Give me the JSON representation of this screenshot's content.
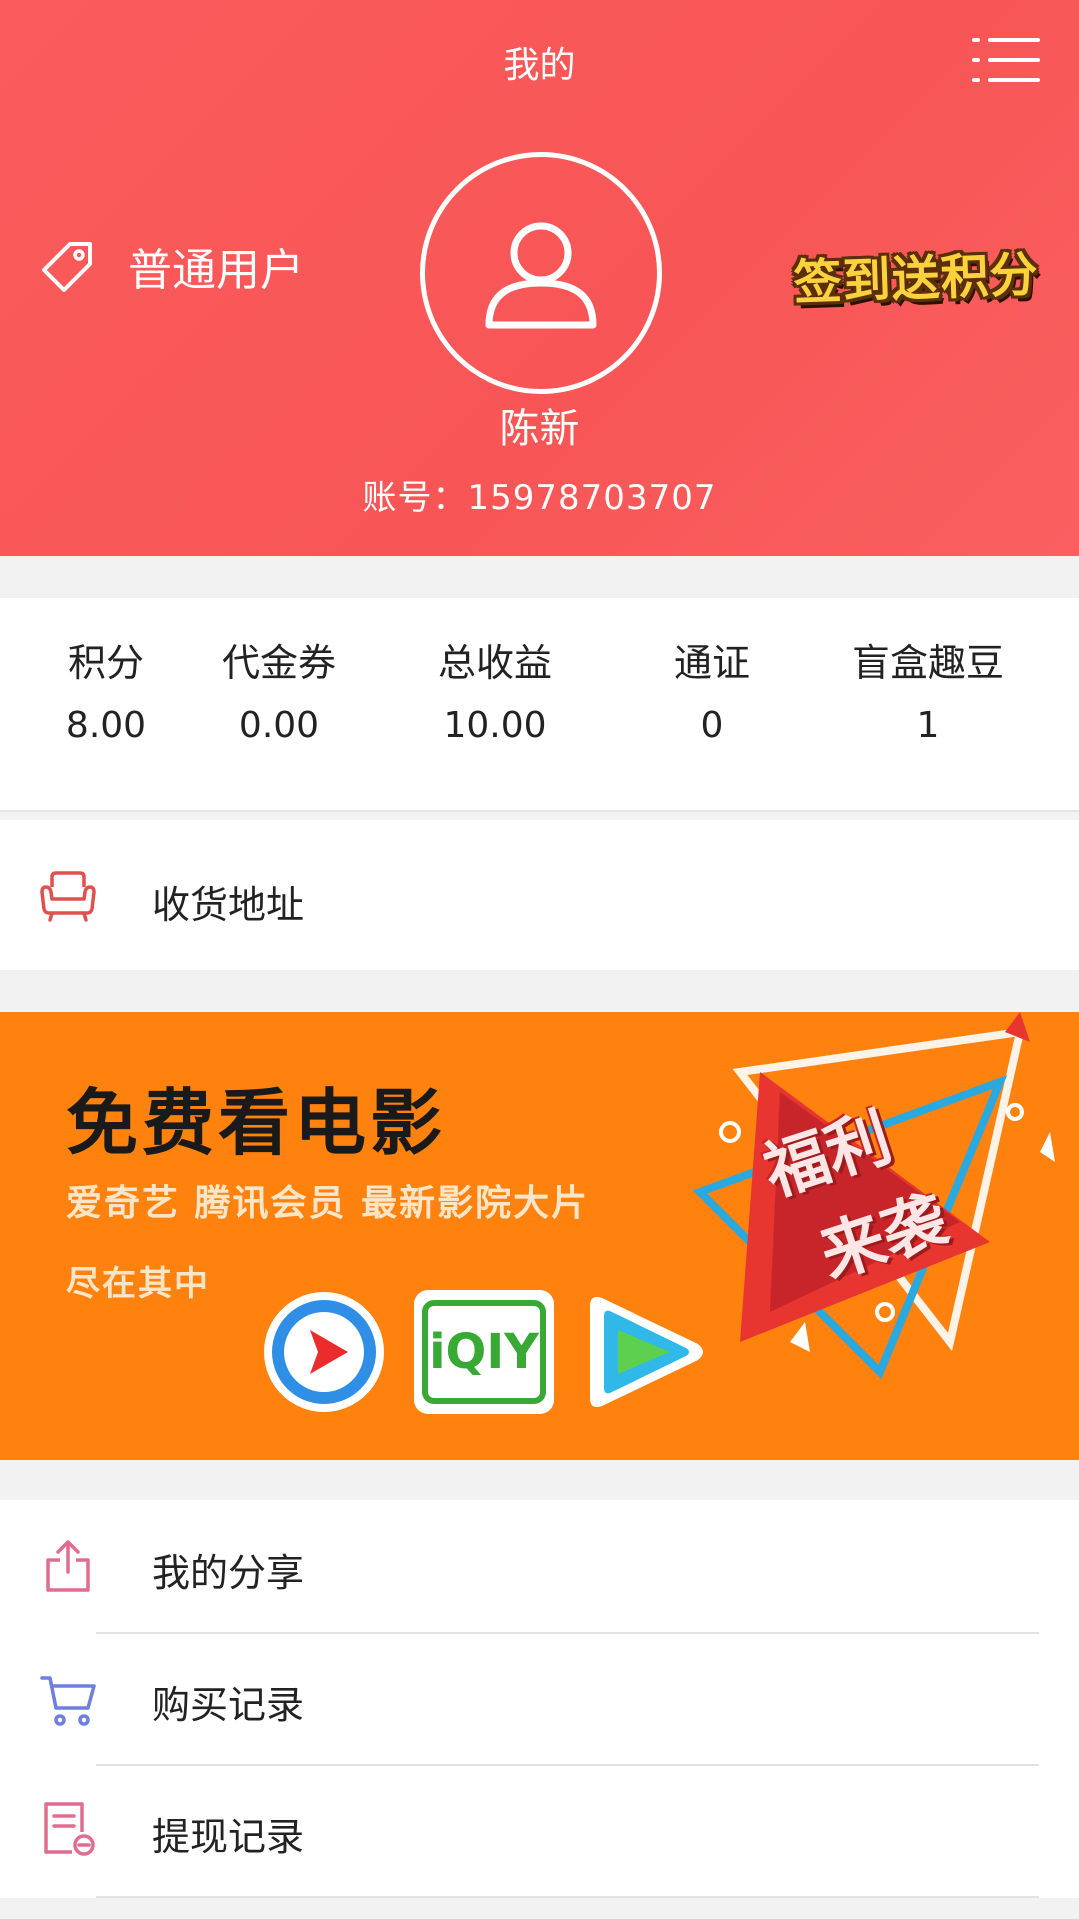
{
  "header": {
    "title": "我的",
    "level": "普通用户",
    "checkin_badge": "签到送积分",
    "user_name": "陈新",
    "account_label": "账号：",
    "account_value": "15978703707"
  },
  "stats": [
    {
      "label": "积分",
      "value": "8.00"
    },
    {
      "label": "代金券",
      "value": "0.00"
    },
    {
      "label": "总收益",
      "value": "10.00"
    },
    {
      "label": "通证",
      "value": "0"
    },
    {
      "label": "盲盒趣豆",
      "value": "1"
    }
  ],
  "address": {
    "label": "收货地址"
  },
  "banner": {
    "title": "免费看电影",
    "subtitle": "爱奇艺 腾讯会员 最新影院大片",
    "subtitle2": "尽在其中",
    "badge_line1": "福利",
    "badge_line2": "来袭",
    "iqiyi_text": "iQIY"
  },
  "menu": [
    {
      "label": "我的分享",
      "icon": "share-icon"
    },
    {
      "label": "购买记录",
      "icon": "cart-icon"
    },
    {
      "label": "提现记录",
      "icon": "withdraw-record-icon"
    }
  ],
  "colors": {
    "header_red": "#fb5b5c",
    "banner_orange": "#ff820f",
    "address_icon": "#e0504f",
    "share_icon": "#e06d8f",
    "cart_icon": "#6e7fe0"
  }
}
